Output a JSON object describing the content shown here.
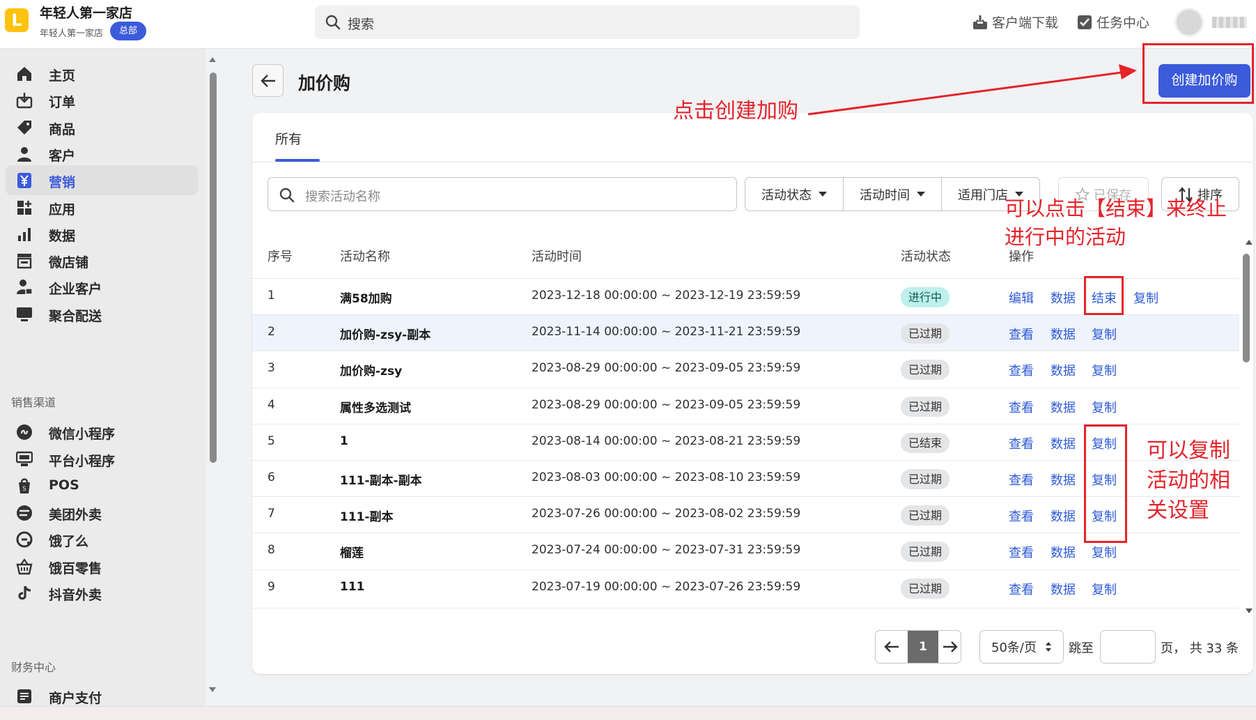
{
  "header": {
    "logo_letter": "L",
    "store_name": "年轻人第一家店",
    "store_sub": "年轻人第一家店",
    "hq_badge": "总部",
    "search_placeholder": "搜索",
    "download_label": "客户端下载",
    "task_label": "任务中心"
  },
  "sidebar": {
    "items": [
      {
        "label": "主页",
        "icon": "home-icon"
      },
      {
        "label": "订单",
        "icon": "order-icon"
      },
      {
        "label": "商品",
        "icon": "tag-icon"
      },
      {
        "label": "客户",
        "icon": "person-icon"
      },
      {
        "label": "营销",
        "icon": "yen-icon",
        "active": true
      },
      {
        "label": "应用",
        "icon": "apps-icon"
      },
      {
        "label": "数据",
        "icon": "chart-icon"
      },
      {
        "label": "微店铺",
        "icon": "store-icon"
      },
      {
        "label": "企业客户",
        "icon": "enterprise-icon"
      },
      {
        "label": "聚合配送",
        "icon": "monitor-icon"
      }
    ],
    "section_sales": "销售渠道",
    "sales_items": [
      {
        "label": "微信小程序",
        "icon": "miniprogram-icon"
      },
      {
        "label": "平台小程序",
        "icon": "platform-icon"
      },
      {
        "label": "POS",
        "icon": "pos-icon"
      },
      {
        "label": "美团外卖",
        "icon": "meituan-icon"
      },
      {
        "label": "饿了么",
        "icon": "eleme-icon"
      },
      {
        "label": "饿百零售",
        "icon": "basket-icon"
      },
      {
        "label": "抖音外卖",
        "icon": "tiktok-icon"
      }
    ],
    "section_finance": "财务中心",
    "finance_items": [
      {
        "label": "商户支付",
        "icon": "payment-icon"
      }
    ]
  },
  "page": {
    "title": "加价购",
    "create_button": "创建加价购",
    "tab_all": "所有",
    "search_placeholder": "搜索活动名称",
    "filters": [
      "活动状态",
      "活动时间",
      "适用门店"
    ],
    "saved_label": "已保存",
    "sort_label": "排序"
  },
  "table": {
    "columns": [
      "序号",
      "活动名称",
      "活动时间",
      "活动状态",
      "操作"
    ],
    "rows": [
      {
        "no": "1",
        "name": "满58加购",
        "time": "2023-12-18 00:00:00 ~ 2023-12-19 23:59:59",
        "status": "进行中",
        "status_type": "active",
        "actions": [
          "编辑",
          "数据",
          "结束",
          "复制"
        ]
      },
      {
        "no": "2",
        "name": "加价购-zsy-副本",
        "time": "2023-11-14 00:00:00 ~ 2023-11-21 23:59:59",
        "status": "已过期",
        "status_type": "expired",
        "actions": [
          "查看",
          "数据",
          "复制"
        ]
      },
      {
        "no": "3",
        "name": "加价购-zsy",
        "time": "2023-08-29 00:00:00 ~ 2023-09-05 23:59:59",
        "status": "已过期",
        "status_type": "expired",
        "actions": [
          "查看",
          "数据",
          "复制"
        ]
      },
      {
        "no": "4",
        "name": "属性多选测试",
        "time": "2023-08-29 00:00:00 ~ 2023-09-05 23:59:59",
        "status": "已过期",
        "status_type": "expired",
        "actions": [
          "查看",
          "数据",
          "复制"
        ]
      },
      {
        "no": "5",
        "name": "1",
        "time": "2023-08-14 00:00:00 ~ 2023-08-21 23:59:59",
        "status": "已结束",
        "status_type": "ended",
        "actions": [
          "查看",
          "数据",
          "复制"
        ]
      },
      {
        "no": "6",
        "name": "111-副本-副本",
        "time": "2023-08-03 00:00:00 ~ 2023-08-10 23:59:59",
        "status": "已过期",
        "status_type": "expired",
        "actions": [
          "查看",
          "数据",
          "复制"
        ]
      },
      {
        "no": "7",
        "name": "111-副本",
        "time": "2023-07-26 00:00:00 ~ 2023-08-02 23:59:59",
        "status": "已过期",
        "status_type": "expired",
        "actions": [
          "查看",
          "数据",
          "复制"
        ]
      },
      {
        "no": "8",
        "name": "榴莲",
        "time": "2023-07-24 00:00:00 ~ 2023-07-31 23:59:59",
        "status": "已过期",
        "status_type": "expired",
        "actions": [
          "查看",
          "数据",
          "复制"
        ]
      },
      {
        "no": "9",
        "name": "111",
        "time": "2023-07-19 00:00:00 ~ 2023-07-26 23:59:59",
        "status": "已过期",
        "status_type": "expired",
        "actions": [
          "查看",
          "数据",
          "复制"
        ]
      }
    ]
  },
  "pagination": {
    "current_page": "1",
    "page_size": "50条/页",
    "jump_label": "跳至",
    "total_text": "页， 共 33 条"
  },
  "annotations": {
    "create_hint": "点击创建加购",
    "end_hint_line1": "可以点击【结束】来终止",
    "end_hint_line2": "进行中的活动",
    "copy_hint_line1": "可以复制",
    "copy_hint_line2": "活动的相",
    "copy_hint_line3": "关设置"
  },
  "colors": {
    "accent": "#3b5bdb",
    "link": "#2e5bd6",
    "annotation": "#e4232a",
    "logo": "#ffc20e"
  }
}
